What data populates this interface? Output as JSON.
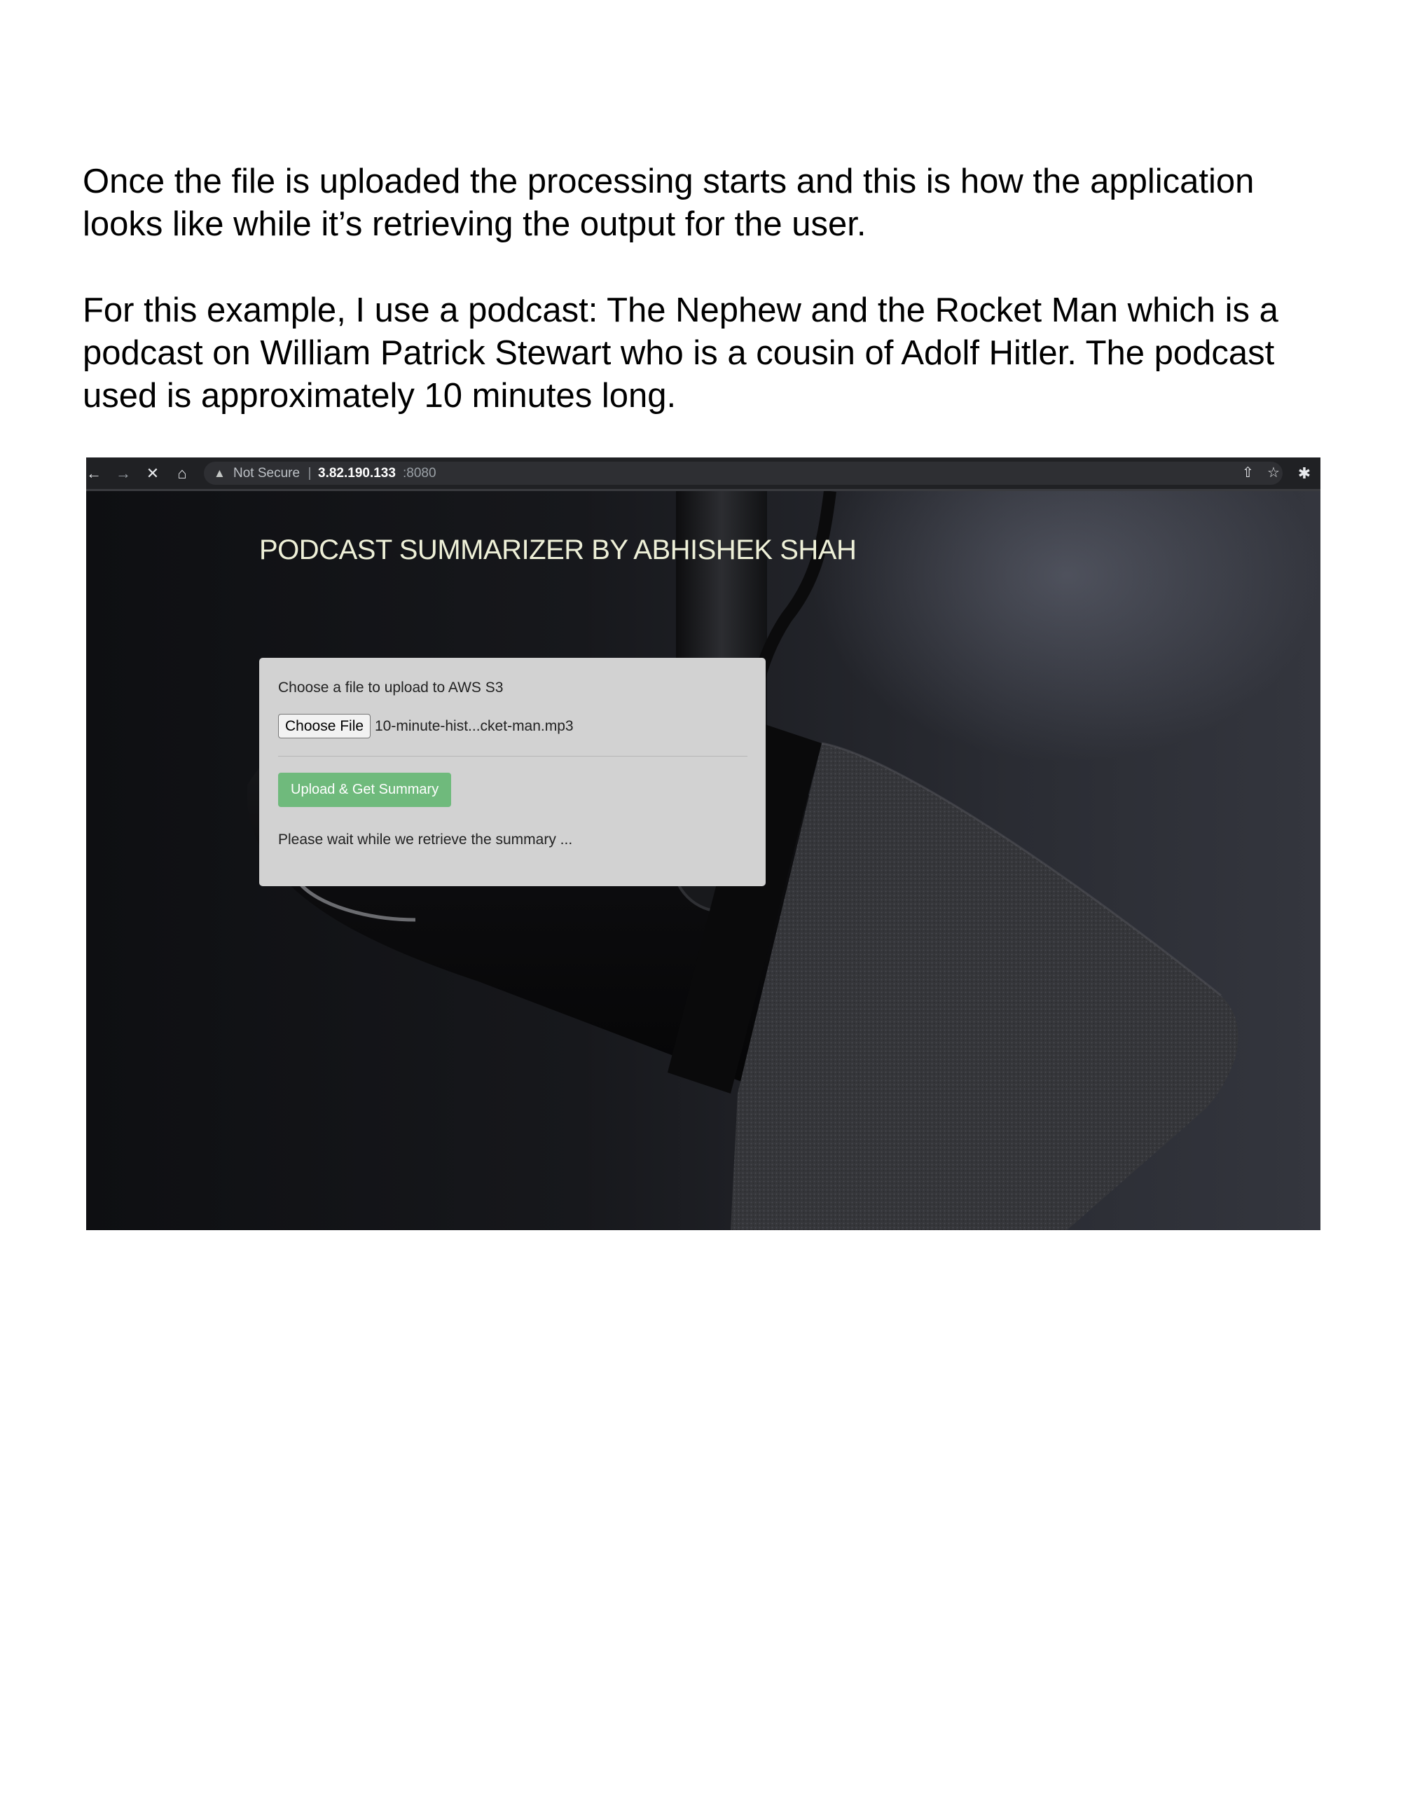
{
  "document": {
    "paragraph_1": "Once the file is uploaded the processing starts and this is how the application looks like while it’s retrieving the output for the user.",
    "paragraph_2": "For this example, I use a podcast: The Nephew and the Rocket Man which is a podcast on William Patrick Stewart who is a cousin of Adolf Hitler. The podcast used is approximately 10 minutes long."
  },
  "browser": {
    "icons": {
      "back": "arrow-left-icon",
      "forward": "arrow-right-icon",
      "stop": "close-icon",
      "home": "home-icon",
      "warning": "warning-icon",
      "share": "share-icon",
      "bookmark": "star-icon",
      "extensions": "puzzle-icon"
    },
    "security_label": "Not Secure",
    "url_host": "3.82.190.133",
    "url_port": ":8080"
  },
  "app": {
    "title": "PODCAST SUMMARIZER BY ABHISHEK SHAH",
    "upload_label": "Choose a file to upload to AWS S3",
    "choose_file_label": "Choose File",
    "selected_file": "10-minute-hist...cket-man.mp3",
    "upload_button_label": "Upload & Get Summary",
    "status_message": "Please wait while we retrieve the summary ..."
  },
  "colors": {
    "title_text": "#eef0d8",
    "card_background": "#d2d2d2",
    "upload_button": "#6fba7c",
    "browser_bar": "#202124"
  }
}
